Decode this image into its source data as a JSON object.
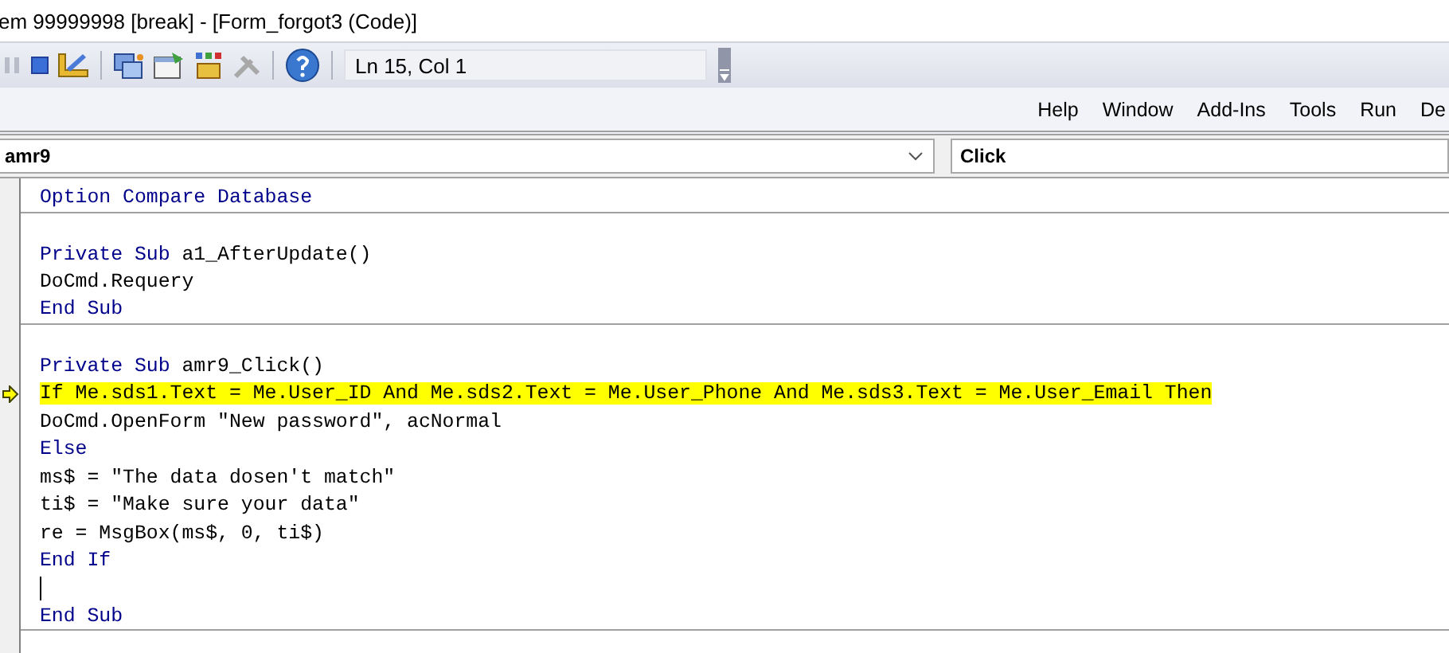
{
  "window": {
    "title": "em 99999998 [break] - [Form_forgot3 (Code)]"
  },
  "toolbar": {
    "position": "Ln 15, Col 1"
  },
  "menu": [
    "Help",
    "Window",
    "Add-Ins",
    "Tools",
    "Run",
    "De"
  ],
  "object_combo": {
    "value": "amr9"
  },
  "procedure_combo": {
    "value": "Click"
  },
  "code_lines": [
    {
      "kind": "code",
      "separator_after": true,
      "tokens": [
        {
          "kind": "keyword",
          "text": "Option Compare Database"
        }
      ]
    },
    {
      "kind": "blank"
    },
    {
      "kind": "code",
      "tokens": [
        {
          "kind": "keyword",
          "text": "Private Sub"
        },
        {
          "kind": "plain",
          "text": " a1_AfterUpdate()"
        }
      ]
    },
    {
      "kind": "code",
      "tokens": [
        {
          "kind": "plain",
          "text": "DoCmd.Requery"
        }
      ]
    },
    {
      "kind": "code",
      "separator_after": true,
      "tokens": [
        {
          "kind": "keyword",
          "text": "End Sub"
        }
      ]
    },
    {
      "kind": "blank"
    },
    {
      "kind": "code",
      "tokens": [
        {
          "kind": "keyword",
          "text": "Private Sub"
        },
        {
          "kind": "plain",
          "text": " amr9_Click()"
        }
      ]
    },
    {
      "kind": "code",
      "execution_point": true,
      "tokens": [
        {
          "kind": "plain",
          "text": "If Me.sds1.Text = Me.User_ID And Me.sds2.Text = Me.User_Phone And Me.sds3.Text = Me.User_Email Then"
        }
      ]
    },
    {
      "kind": "code",
      "tokens": [
        {
          "kind": "plain",
          "text": "DoCmd.OpenForm \"New password\", acNormal"
        }
      ]
    },
    {
      "kind": "code",
      "tokens": [
        {
          "kind": "keyword",
          "text": "Else"
        }
      ]
    },
    {
      "kind": "code",
      "tokens": [
        {
          "kind": "plain",
          "text": "ms$ = \"The data dosen't match\""
        }
      ]
    },
    {
      "kind": "code",
      "tokens": [
        {
          "kind": "plain",
          "text": "ti$ = \"Make sure your data\""
        }
      ]
    },
    {
      "kind": "code",
      "tokens": [
        {
          "kind": "plain",
          "text": "re = MsgBox(ms$, 0, ti$)"
        }
      ]
    },
    {
      "kind": "code",
      "tokens": [
        {
          "kind": "keyword",
          "text": "End If"
        }
      ]
    },
    {
      "kind": "blank",
      "caret": true
    },
    {
      "kind": "code",
      "separator_after": true,
      "tokens": [
        {
          "kind": "keyword",
          "text": "End Sub"
        }
      ]
    }
  ]
}
